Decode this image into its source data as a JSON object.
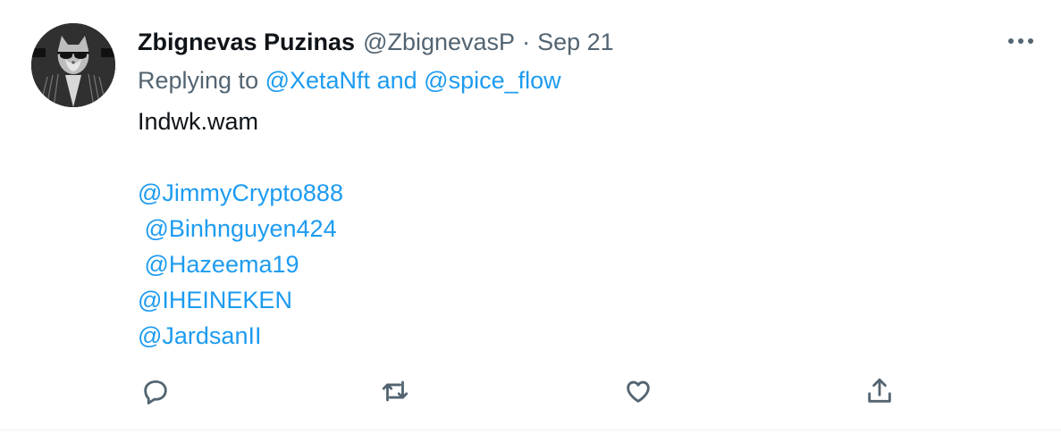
{
  "tweet": {
    "author_name": "Zbignevas Puzinas",
    "author_handle": "@ZbignevasP",
    "separator": "·",
    "date": "Sep 21",
    "replying_prefix": "Replying to",
    "replying_to_1": "@XetaNft",
    "replying_joiner": "and",
    "replying_to_2": "@spice_flow",
    "text_first_line": "Indwk.wam",
    "mentions": [
      "@JimmyCrypto888",
      " @Binhnguyen424",
      " @Hazeema19",
      "@IHEINEKEN",
      "@JardsanII"
    ]
  },
  "icons": {
    "more": "more-horizontal-icon",
    "reply": "reply-icon",
    "retweet": "retweet-icon",
    "like": "heart-icon",
    "share": "share-icon"
  },
  "colors": {
    "link": "#1d9bf0",
    "secondary_text": "#536471",
    "primary_text": "#0f1419"
  }
}
